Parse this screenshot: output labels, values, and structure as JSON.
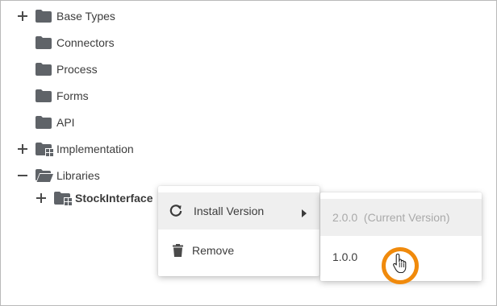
{
  "tree": {
    "items": [
      {
        "label": "Base Types",
        "expander": "plus-icon",
        "icon": "folder-icon"
      },
      {
        "label": "Connectors",
        "expander": "",
        "icon": "folder-icon"
      },
      {
        "label": "Process",
        "expander": "",
        "icon": "folder-icon"
      },
      {
        "label": "Forms",
        "expander": "",
        "icon": "folder-icon"
      },
      {
        "label": "API",
        "expander": "",
        "icon": "folder-icon"
      },
      {
        "label": "Implementation",
        "expander": "plus-icon",
        "icon": "folder-module-icon"
      },
      {
        "label": "Libraries",
        "expander": "minus-icon",
        "icon": "folder-open-icon"
      },
      {
        "label": "StockInterface",
        "expander": "plus-icon",
        "icon": "folder-module-icon"
      }
    ]
  },
  "context_menu": {
    "install_version_label": "Install Version",
    "remove_label": "Remove",
    "install_icon": "refresh-icon",
    "remove_icon": "trash-icon",
    "submenu_arrow_icon": "caret-right-icon"
  },
  "submenu": {
    "items": [
      {
        "label": "2.0.0  (Current Version)",
        "disabled": true
      },
      {
        "label": "1.0.0",
        "disabled": false
      }
    ]
  },
  "colors": {
    "folder": "#5f6368",
    "highlight_ring": "#f08a0c",
    "active_item_bg": "#efefef",
    "disabled_text": "#a9a9a9",
    "text": "#3c3c3c"
  },
  "cursor": "hand-pointer-icon"
}
